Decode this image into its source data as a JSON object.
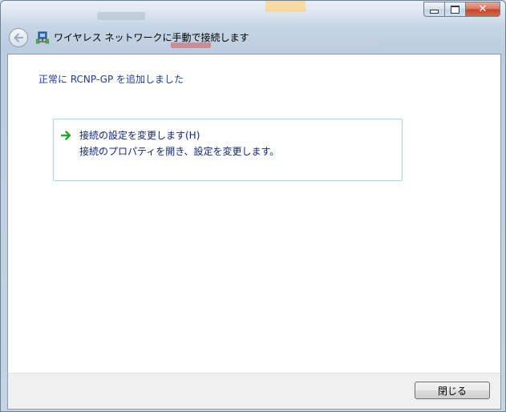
{
  "window": {
    "title": "ワイヤレス ネットワークに手動で接続します"
  },
  "caption": {
    "close_glyph": "✕"
  },
  "content": {
    "success_message": "正常に RCNP-GP を追加しました",
    "command_link": {
      "title": "接続の設定を変更します(H)",
      "description": "接続のプロパティを開き、設定を変更します。"
    }
  },
  "footer": {
    "close_label": "閉じる"
  },
  "icons": {
    "back": "back-arrow-icon",
    "network": "wireless-network-icon",
    "command_arrow": "green-arrow-icon"
  },
  "colors": {
    "link_text": "#10257a",
    "success_text": "#1e3e9e",
    "command_border": "#a7d8ea",
    "arrow_green": "#2aa52a"
  }
}
